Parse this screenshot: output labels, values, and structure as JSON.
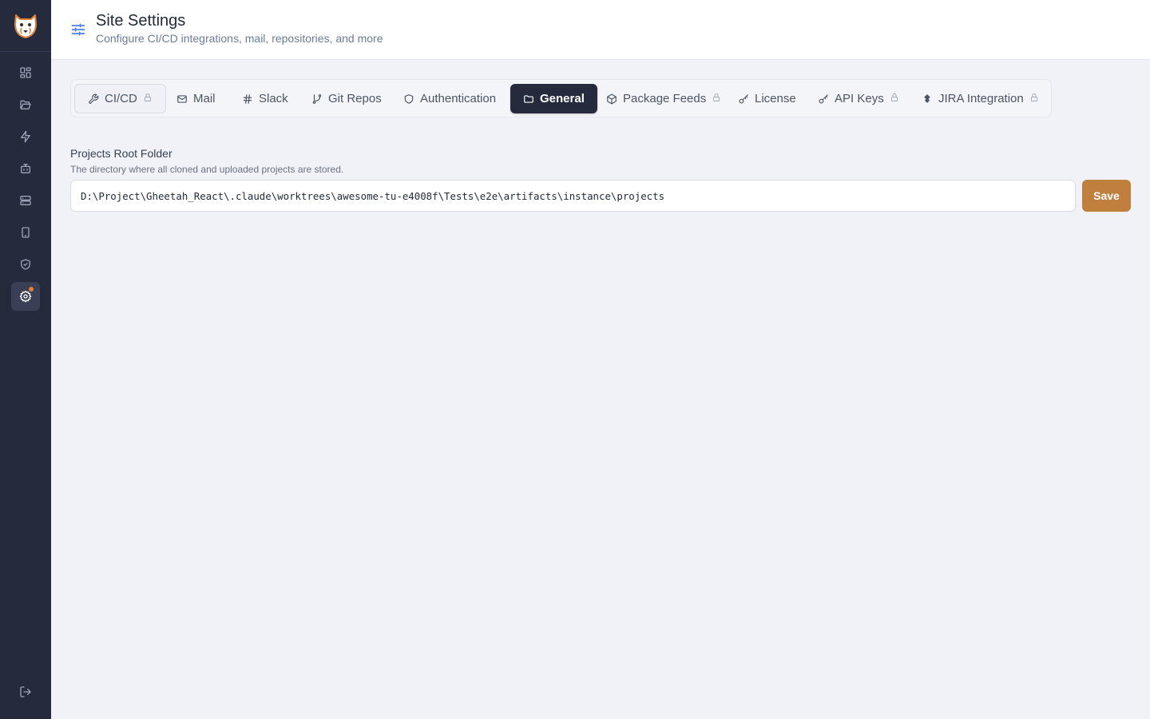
{
  "header": {
    "title": "Site Settings",
    "subtitle": "Configure CI/CD integrations, mail, repositories, and more"
  },
  "sidebar": {
    "items": [
      {
        "icon": "dashboard-icon"
      },
      {
        "icon": "folder-open-icon"
      },
      {
        "icon": "lightning-icon"
      },
      {
        "icon": "bot-icon"
      },
      {
        "icon": "server-icon"
      },
      {
        "icon": "tablet-icon"
      },
      {
        "icon": "shield-check-icon"
      },
      {
        "icon": "gear-icon",
        "active": true,
        "has_notification": true
      }
    ],
    "logout_icon": "logout-icon"
  },
  "tabs": [
    {
      "label": "CI/CD",
      "icon": "wrench-icon",
      "locked": true
    },
    {
      "label": "Mail",
      "icon": "mail-icon",
      "locked": false
    },
    {
      "label": "Slack",
      "icon": "hash-icon",
      "locked": false
    },
    {
      "label": "Git Repos",
      "icon": "git-branch-icon",
      "locked": false
    },
    {
      "label": "Authentication",
      "icon": "shield-icon",
      "locked": false
    },
    {
      "label": "General",
      "icon": "folder-icon",
      "locked": false,
      "active": true
    },
    {
      "label": "Package Feeds",
      "icon": "package-icon",
      "locked": true
    },
    {
      "label": "License",
      "icon": "key-icon",
      "locked": false
    },
    {
      "label": "API Keys",
      "icon": "key-icon",
      "locked": true
    },
    {
      "label": "JIRA Integration",
      "icon": "jira-icon",
      "locked": true
    }
  ],
  "general": {
    "projects_root": {
      "label": "Projects Root Folder",
      "help": "The directory where all cloned and uploaded projects are stored.",
      "value": "D:\\Project\\Gheetah_React\\.claude\\worktrees\\awesome-tu-e4008f\\Tests\\e2e\\artifacts\\instance\\projects"
    },
    "save_label": "Save"
  },
  "colors": {
    "sidebar_bg": "#262a3d",
    "accent": "#c17f3e",
    "active_tab_bg": "#262a3d",
    "header_icon": "#4f7fe6",
    "notification": "#e07f3b"
  }
}
